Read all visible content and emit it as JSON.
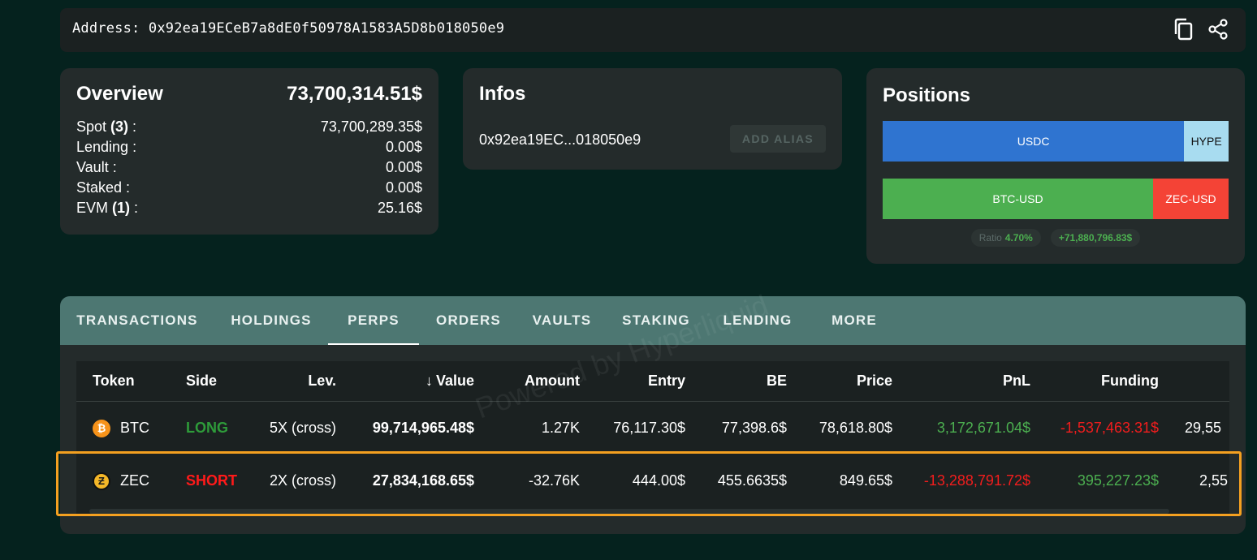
{
  "address_bar": {
    "label": "Address:",
    "address": "0x92ea19ECeB7a8dE0f50978A1583A5D8b018050e9",
    "copy_icon": "copy-icon",
    "share_icon": "share-icon"
  },
  "overview": {
    "title": "Overview",
    "total": "73,700,314.51$",
    "rows": [
      {
        "label": "Spot",
        "count": "(3)",
        "suffix": " :",
        "value": "73,700,289.35$"
      },
      {
        "label": "Lending :",
        "count": "",
        "suffix": "",
        "value": "0.00$"
      },
      {
        "label": "Vault :",
        "count": "",
        "suffix": "",
        "value": "0.00$"
      },
      {
        "label": "Staked :",
        "count": "",
        "suffix": "",
        "value": "0.00$"
      },
      {
        "label": "EVM",
        "count": "(1)",
        "suffix": " :",
        "value": "25.16$"
      }
    ]
  },
  "infos": {
    "title": "Infos",
    "short_address": "0x92ea19EC...018050e9",
    "add_alias_label": "ADD ALIAS"
  },
  "positions": {
    "title": "Positions",
    "bar1": {
      "left_label": "USDC",
      "right_label": "HYPE"
    },
    "bar2": {
      "left_label": "BTC-USD",
      "right_label": "ZEC-USD"
    },
    "ratio_label": "Ratio",
    "ratio_value": "4.70%",
    "pnl_value": "+71,880,796.83$",
    "colors": {
      "usdc": "#2f74d0",
      "hype": "#a8dcf0",
      "btc": "#4caf50",
      "zec": "#f44336"
    }
  },
  "tabs": [
    {
      "label": "TRANSACTIONS",
      "active": false
    },
    {
      "label": "HOLDINGS",
      "active": false
    },
    {
      "label": "PERPS",
      "active": true
    },
    {
      "label": "ORDERS",
      "active": false
    },
    {
      "label": "VAULTS",
      "active": false
    },
    {
      "label": "STAKING",
      "active": false
    },
    {
      "label": "LENDING",
      "active": false
    },
    {
      "label": "MORE",
      "active": false
    }
  ],
  "table": {
    "headers": {
      "token": "Token",
      "side": "Side",
      "lev": "Lev.",
      "value_arrow": "↓",
      "value": "Value",
      "amount": "Amount",
      "entry": "Entry",
      "be": "BE",
      "price": "Price",
      "pnl": "PnL",
      "funding": "Funding"
    },
    "rows": [
      {
        "token": "BTC",
        "icon": "bitcoin-icon",
        "side": "LONG",
        "lev": "5X (cross)",
        "value": "99,714,965.48$",
        "amount": "1.27K",
        "entry": "76,117.30$",
        "be": "77,398.6$",
        "price": "78,618.80$",
        "pnl": "3,172,671.04$",
        "funding": "-1,537,463.31$",
        "extra": "29,55"
      },
      {
        "token": "ZEC",
        "icon": "zcash-icon",
        "side": "SHORT",
        "lev": "2X (cross)",
        "value": "27,834,168.65$",
        "amount": "-32.76K",
        "entry": "444.00$",
        "be": "455.6635$",
        "price": "849.65$",
        "pnl": "-13,288,791.72$",
        "funding": "395,227.23$",
        "extra": "2,55"
      }
    ]
  },
  "watermark": "Powered by Hyperliquid",
  "highlight_color": "#f4a020"
}
